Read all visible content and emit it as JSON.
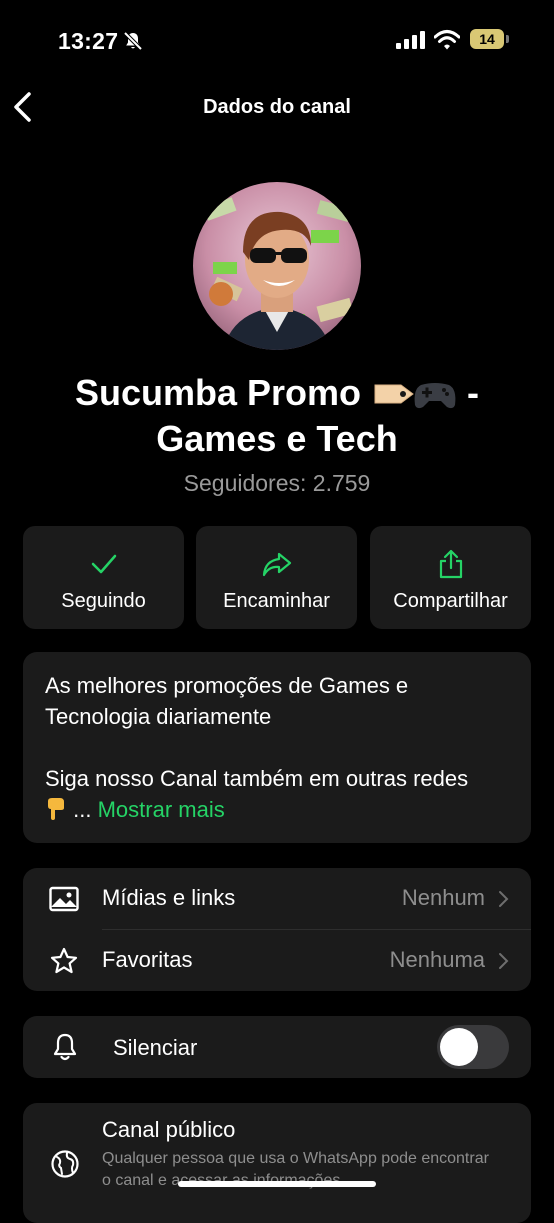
{
  "status_bar": {
    "time": "13:27",
    "battery": "14",
    "icons": [
      "bell-slash-icon",
      "signal-icon",
      "wifi-icon",
      "battery-icon"
    ]
  },
  "header": {
    "title": "Dados do canal",
    "back_icon": "chevron-left-icon"
  },
  "channel": {
    "name_line1": "Sucumba Promo",
    "name_dash": " -",
    "name_line2": "Games e Tech",
    "followers": "Seguidores: 2.759"
  },
  "actions": [
    {
      "label": "Seguindo",
      "icon": "checkmark-icon"
    },
    {
      "label": "Encaminhar",
      "icon": "forward-arrow-icon"
    },
    {
      "label": "Compartilhar",
      "icon": "share-icon"
    }
  ],
  "description": {
    "line1": "As melhores promoções de Games e Tecnologia diariamente",
    "line2": "Siga nosso Canal também em outras redes",
    "ellipsis": "...",
    "more": "Mostrar mais"
  },
  "list": [
    {
      "label": "Mídias e links",
      "value": "Nenhum",
      "icon": "image-icon"
    },
    {
      "label": "Favoritas",
      "value": "Nenhuma",
      "icon": "star-icon"
    }
  ],
  "mute": {
    "label": "Silenciar",
    "enabled": false,
    "icon": "bell-icon"
  },
  "public": {
    "title": "Canal público",
    "subtitle": "Qualquer pessoa que usa o WhatsApp pode encontrar o canal e acessar as informações",
    "icon": "globe-icon"
  },
  "colors": {
    "accent": "#25d366",
    "card": "#1b1b1b",
    "background": "#000000"
  }
}
